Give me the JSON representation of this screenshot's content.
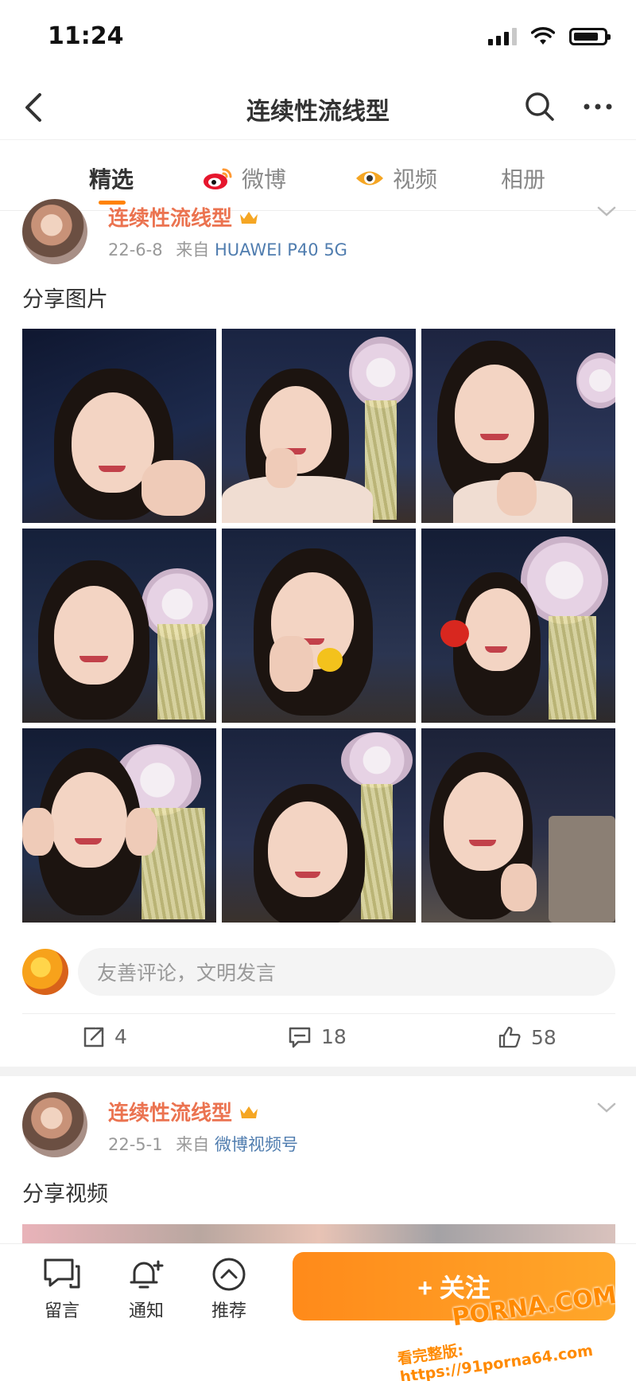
{
  "status": {
    "time": "11:24"
  },
  "nav": {
    "title": "连续性流线型"
  },
  "tabs": [
    {
      "label": "精选",
      "active": true
    },
    {
      "label": "微博",
      "icon": "weibo-logo-icon"
    },
    {
      "label": "视频",
      "icon": "video-eye-icon"
    },
    {
      "label": "相册"
    }
  ],
  "posts": [
    {
      "username": "连续性流线型",
      "date": "22-6-8",
      "from_label": "来自",
      "source": "HUAWEI P40 5G",
      "text": "分享图片",
      "photo_count": 9
    },
    {
      "username": "连续性流线型",
      "date": "22-5-1",
      "from_label": "来自",
      "source": "微博视频号",
      "text": "分享视频"
    }
  ],
  "comment": {
    "placeholder": "友善评论，文明发言"
  },
  "actions": {
    "repost": "4",
    "comments": "18",
    "likes": "58"
  },
  "bottom": {
    "message": "留言",
    "notify": "通知",
    "recommend": "推荐",
    "follow": "+ 关注"
  },
  "watermark": {
    "line1": "PORNA.COM",
    "line2": "看完整版: https://91porna64.com"
  },
  "colors": {
    "accent": "#ff8200",
    "username": "#eb7350",
    "link": "#507daf"
  }
}
